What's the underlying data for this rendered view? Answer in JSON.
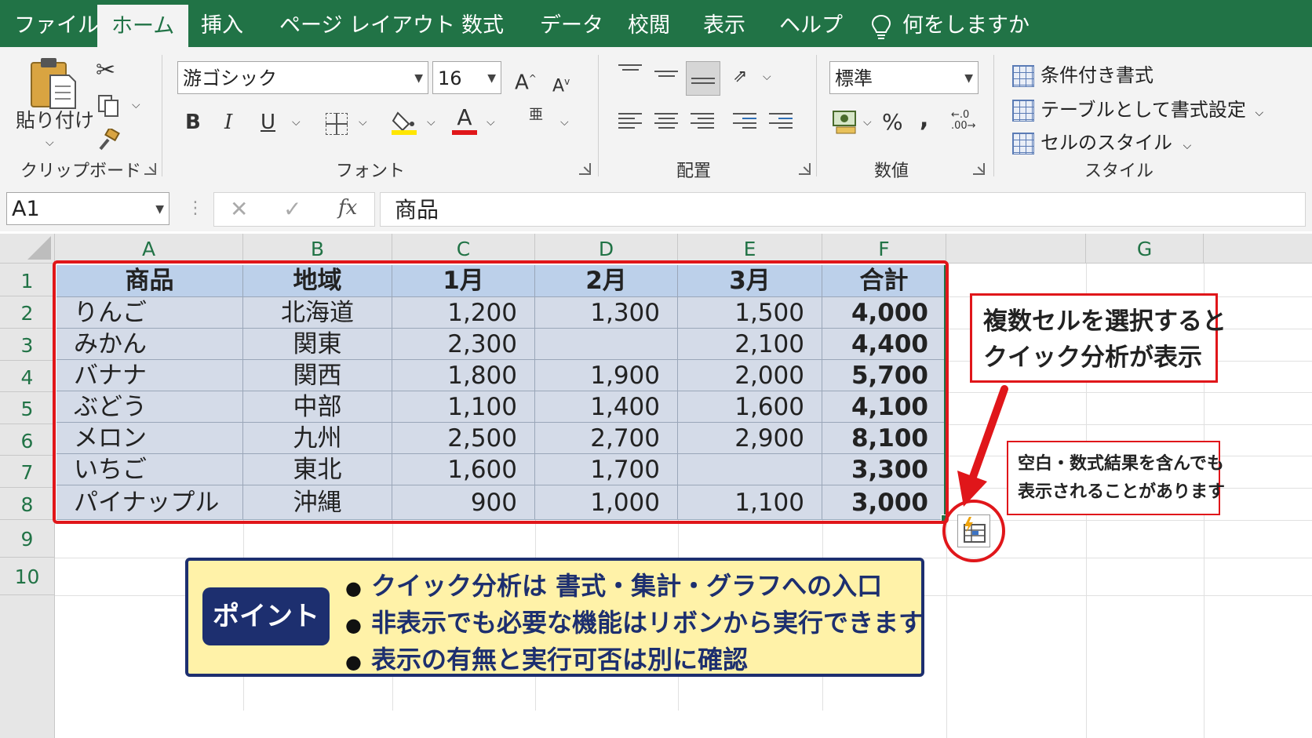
{
  "tabs": [
    "ファイル",
    "ホーム",
    "挿入",
    "ページ レイアウト",
    "数式",
    "データ",
    "校閲",
    "表示",
    "ヘルプ"
  ],
  "tell_me": "何をしますか",
  "ribbon": {
    "clipboard": {
      "paste": "貼り付け",
      "label": "クリップボード"
    },
    "font": {
      "name": "游ゴシック",
      "size": "16",
      "label": "フォント"
    },
    "alignment": {
      "label": "配置"
    },
    "number": {
      "format": "標準",
      "label": "数値",
      "percent": "%",
      "comma": ","
    },
    "styles": {
      "conditional": "条件付き書式",
      "table": "テーブルとして書式設定",
      "cell": "セルのスタイル",
      "label": "スタイル"
    }
  },
  "formula_bar": {
    "name_box": "A1",
    "fx": "fx",
    "content": "商品"
  },
  "columns": [
    "A",
    "B",
    "C",
    "D",
    "E",
    "F",
    "G"
  ],
  "rows": [
    "1",
    "2",
    "3",
    "4",
    "5",
    "6",
    "7",
    "8",
    "9",
    "10"
  ],
  "table": {
    "header": [
      "商品",
      "地域",
      "1月",
      "2月",
      "3月",
      "合計"
    ],
    "rows": [
      [
        "りんご",
        "北海道",
        "1,200",
        "1,300",
        "1,500",
        "4,000"
      ],
      [
        "みかん",
        "関東",
        "2,300",
        "",
        "2,100",
        "4,400"
      ],
      [
        "バナナ",
        "関西",
        "1,800",
        "1,900",
        "2,000",
        "5,700"
      ],
      [
        "ぶどう",
        "中部",
        "1,100",
        "1,400",
        "1,600",
        "4,100"
      ],
      [
        "メロン",
        "九州",
        "2,500",
        "2,700",
        "2,900",
        "8,100"
      ],
      [
        "いちご",
        "東北",
        "1,600",
        "1,700",
        "",
        "3,300"
      ],
      [
        "パイナップル",
        "沖縄",
        "900",
        "1,000",
        "1,100",
        "3,000"
      ]
    ]
  },
  "callout_main": [
    "複数セルを選択すると",
    "クイック分析が表示"
  ],
  "callout_note": [
    "空白・数式結果を含んでも",
    "表示されることがあります"
  ],
  "point": {
    "label": "ポイント",
    "bullets": [
      "クイック分析は 書式・集計・グラフへの入口",
      "非表示でも必要な機能はリボンから実行できます",
      "表示の有無と実行可否は別に確認"
    ]
  },
  "colors": {
    "excel_green": "#217346",
    "highlight_red": "#e0161a",
    "selection_fill": "#d4dbe8",
    "header_fill": "#bcd0ea",
    "point_bg": "#fff2a8",
    "point_border": "#1d2f6f"
  }
}
